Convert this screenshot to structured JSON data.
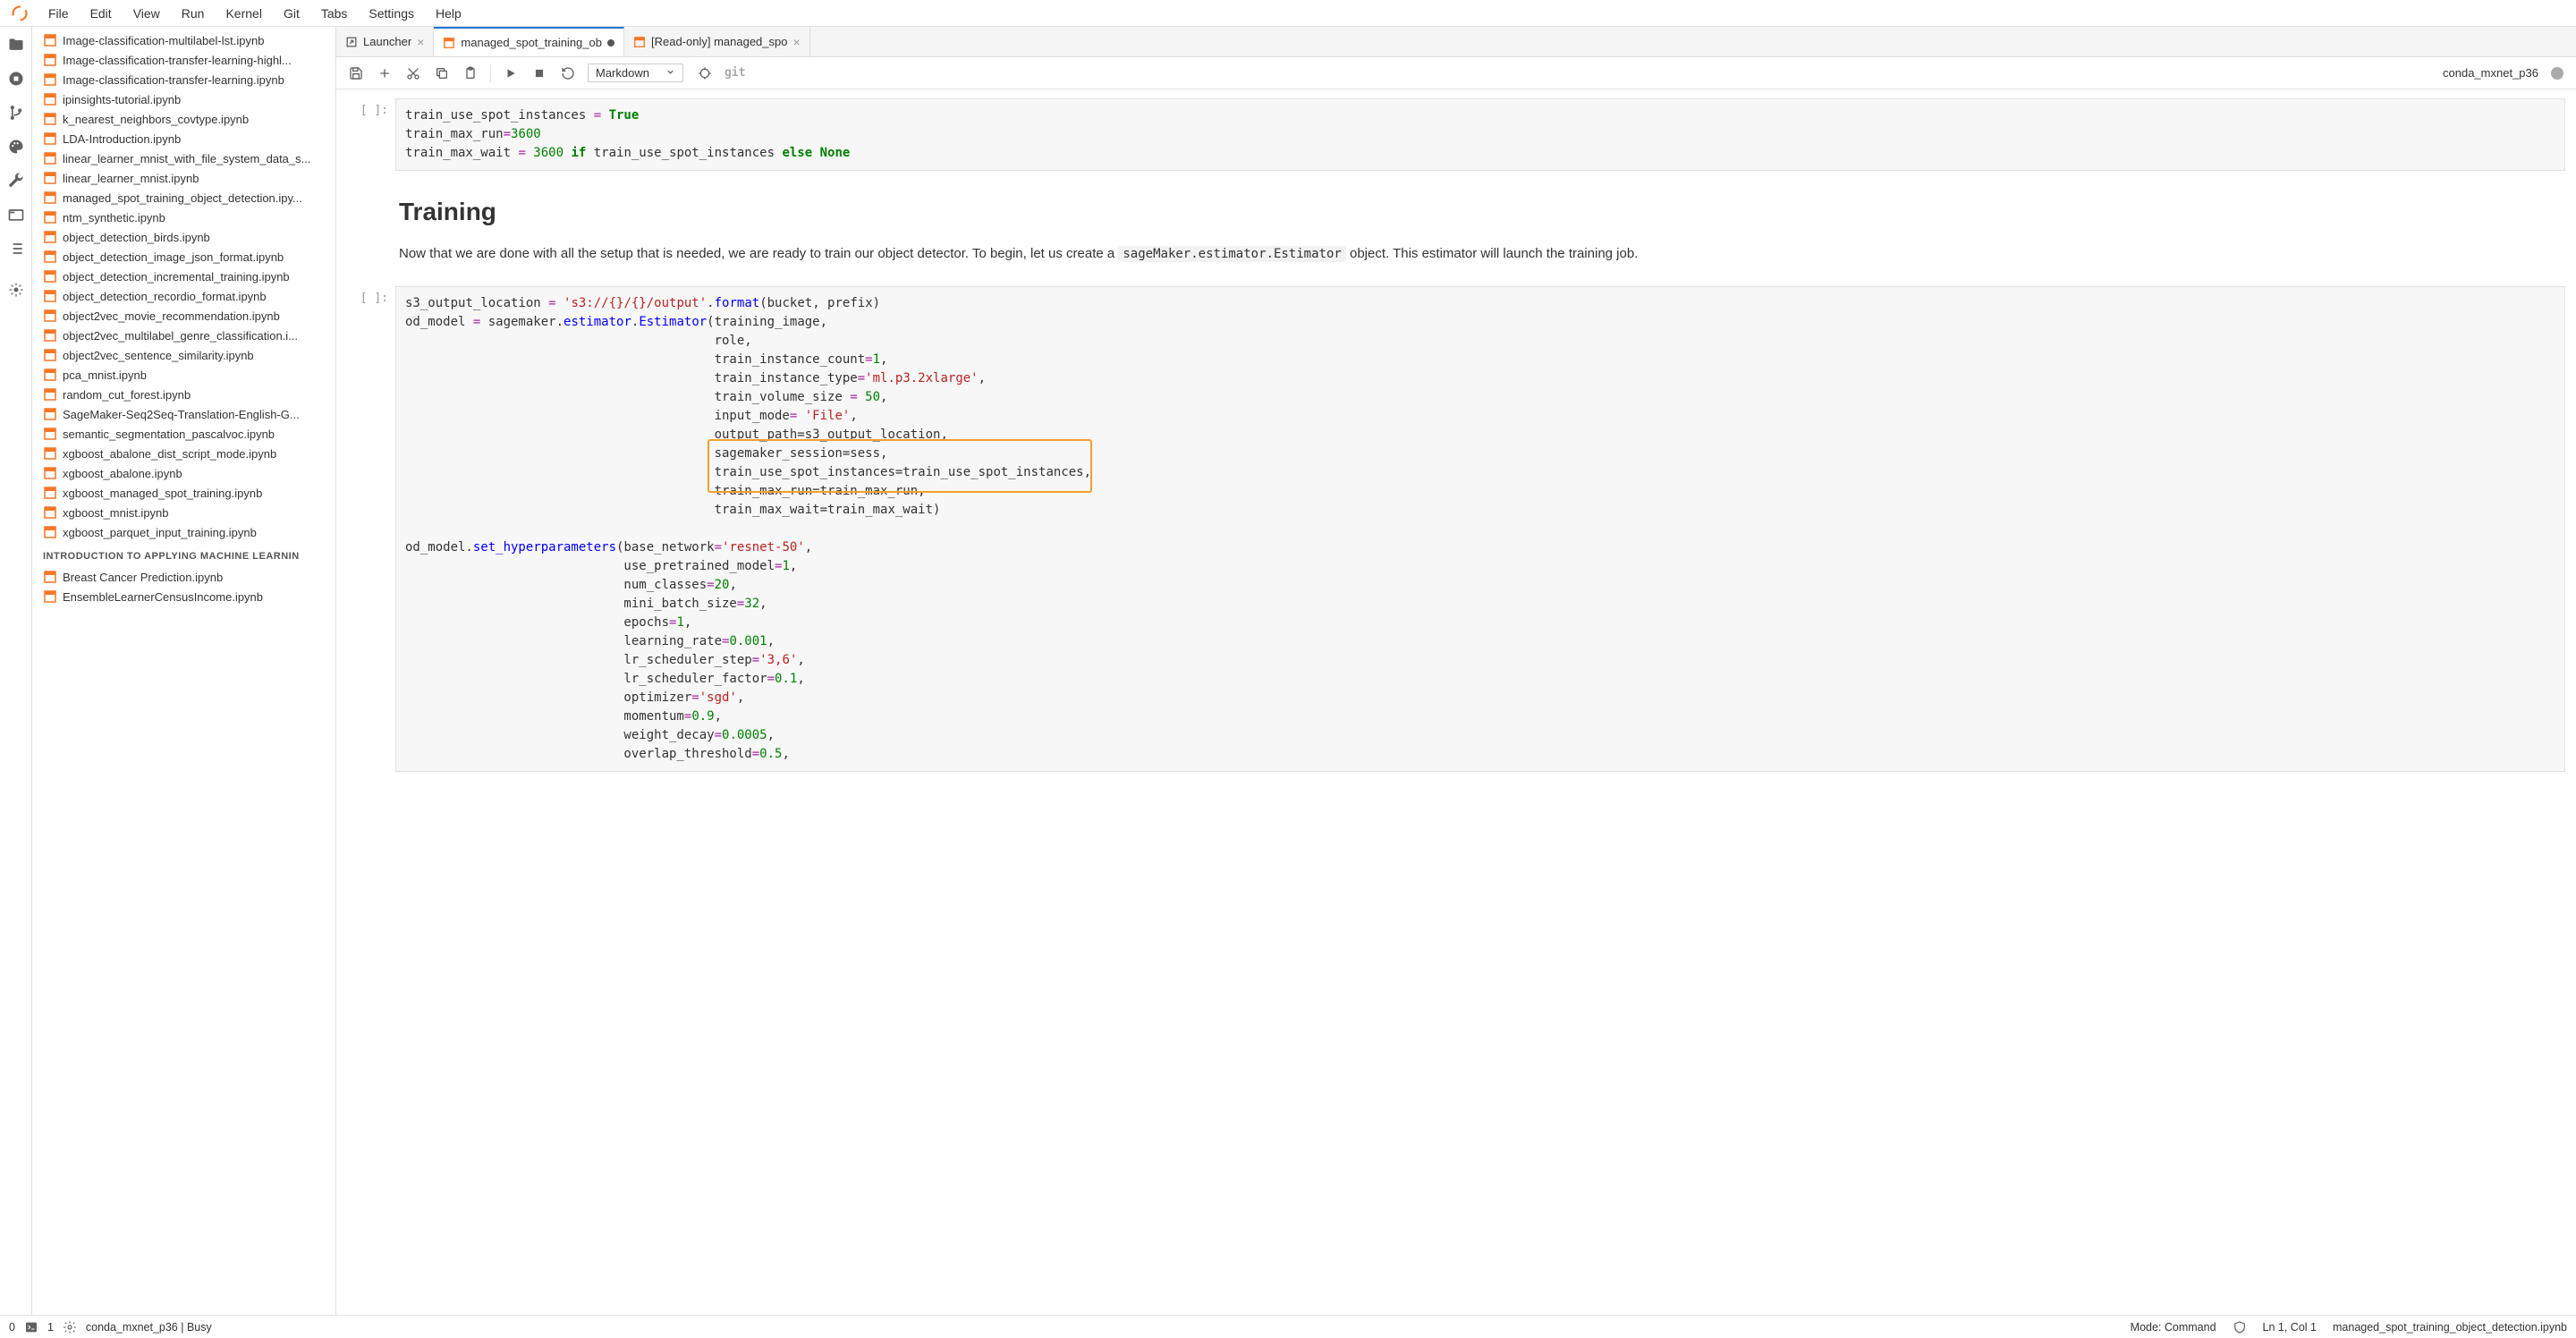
{
  "menu": [
    "File",
    "Edit",
    "View",
    "Run",
    "Kernel",
    "Git",
    "Tabs",
    "Settings",
    "Help"
  ],
  "files": [
    "Image-classification-multilabel-lst.ipynb",
    "Image-classification-transfer-learning-highl...",
    "Image-classification-transfer-learning.ipynb",
    "ipinsights-tutorial.ipynb",
    "k_nearest_neighbors_covtype.ipynb",
    "LDA-Introduction.ipynb",
    "linear_learner_mnist_with_file_system_data_s...",
    "linear_learner_mnist.ipynb",
    "managed_spot_training_object_detection.ipy...",
    "ntm_synthetic.ipynb",
    "object_detection_birds.ipynb",
    "object_detection_image_json_format.ipynb",
    "object_detection_incremental_training.ipynb",
    "object_detection_recordio_format.ipynb",
    "object2vec_movie_recommendation.ipynb",
    "object2vec_multilabel_genre_classification.i...",
    "object2vec_sentence_similarity.ipynb",
    "pca_mnist.ipynb",
    "random_cut_forest.ipynb",
    "SageMaker-Seq2Seq-Translation-English-G...",
    "semantic_segmentation_pascalvoc.ipynb",
    "xgboost_abalone_dist_script_mode.ipynb",
    "xgboost_abalone.ipynb",
    "xgboost_managed_spot_training.ipynb",
    "xgboost_mnist.ipynb",
    "xgboost_parquet_input_training.ipynb"
  ],
  "section_header": "INTRODUCTION TO APPLYING MACHINE LEARNIN",
  "files2": [
    "Breast Cancer Prediction.ipynb",
    "EnsembleLearnerCensusIncome.ipynb"
  ],
  "tabs": {
    "launcher": "Launcher",
    "active": "managed_spot_training_ob",
    "readonly": "[Read-only] managed_spo"
  },
  "toolbar": {
    "celltype": "Markdown",
    "git": "git",
    "kernel": "conda_mxnet_p36"
  },
  "cell1": {
    "prompt": "[ ]:",
    "l1a": "train_use_spot_instances ",
    "l1b": "= ",
    "l1c": "True",
    "l2a": "train_max_run",
    "l2b": "=",
    "l2c": "3600",
    "l3a": "train_max_wait ",
    "l3b": "= ",
    "l3c": "3600",
    "l3d": " if ",
    "l3e": "train_use_spot_instances ",
    "l3f": "else ",
    "l3g": "None"
  },
  "md": {
    "heading": "Training",
    "text_a": "Now that we are done with all the setup that is needed, we are ready to train our object detector. To begin, let us create a ",
    "code": "sageMaker.estimator.Estimator",
    "text_b": " object. This estimator will launch the training job."
  },
  "cell2": {
    "prompt": "[ ]:",
    "l1a": "s3_output_location ",
    "l1b": "= ",
    "l1c": "'s3://{}/{}/output'",
    "l1d": ".",
    "l1e": "format",
    "l1f": "(bucket, prefix)",
    "l2a": "od_model ",
    "l2b": "= ",
    "l2c": "sagemaker",
    "l2d": ".",
    "l2e": "estimator",
    "l2f": ".",
    "l2g": "Estimator",
    "l2h": "(training_image,",
    "l3": "                                         role,",
    "l4a": "                                         train_instance_count",
    "l4b": "=",
    "l4c": "1",
    "l4d": ",",
    "l5a": "                                         train_instance_type",
    "l5b": "=",
    "l5c": "'ml.p3.2xlarge'",
    "l5d": ",",
    "l6a": "                                         train_volume_size ",
    "l6b": "= ",
    "l6c": "50",
    "l6d": ",",
    "l7a": "                                         input_mode",
    "l7b": "= ",
    "l7c": "'File'",
    "l7d": ",",
    "l8": "                                         output_path=s3_output_location,",
    "l9": "                                         sagemaker_session=sess,",
    "l10": "                                         train_use_spot_instances=train_use_spot_instances,",
    "l11": "                                         train_max_run=train_max_run,",
    "l12": "                                         train_max_wait=train_max_wait)",
    "blank": "",
    "l13a": "od_model.",
    "l13b": "set_hyperparameters",
    "l13c": "(base_network",
    "l13d": "=",
    "l13e": "'resnet-50'",
    "l13f": ",",
    "l14a": "                             use_pretrained_model",
    "l14b": "=",
    "l14c": "1",
    "l14d": ",",
    "l15a": "                             num_classes",
    "l15b": "=",
    "l15c": "20",
    "l15d": ",",
    "l16a": "                             mini_batch_size",
    "l16b": "=",
    "l16c": "32",
    "l16d": ",",
    "l17a": "                             epochs",
    "l17b": "=",
    "l17c": "1",
    "l17d": ",",
    "l18a": "                             learning_rate",
    "l18b": "=",
    "l18c": "0.001",
    "l18d": ",",
    "l19a": "                             lr_scheduler_step",
    "l19b": "=",
    "l19c": "'3,6'",
    "l19d": ",",
    "l20a": "                             lr_scheduler_factor",
    "l20b": "=",
    "l20c": "0.1",
    "l20d": ",",
    "l21a": "                             optimizer",
    "l21b": "=",
    "l21c": "'sgd'",
    "l21d": ",",
    "l22a": "                             momentum",
    "l22b": "=",
    "l22c": "0.9",
    "l22d": ",",
    "l23a": "                             weight_decay",
    "l23b": "=",
    "l23c": "0.0005",
    "l23d": ",",
    "l24a": "                             overlap_threshold",
    "l24b": "=",
    "l24c": "0.5",
    "l24d": ","
  },
  "status": {
    "terminals": "0",
    "kernels": "1",
    "kernel": "conda_mxnet_p36 | Busy",
    "mode": "Mode: Command",
    "pos": "Ln 1, Col 1",
    "file": "managed_spot_training_object_detection.ipynb"
  }
}
